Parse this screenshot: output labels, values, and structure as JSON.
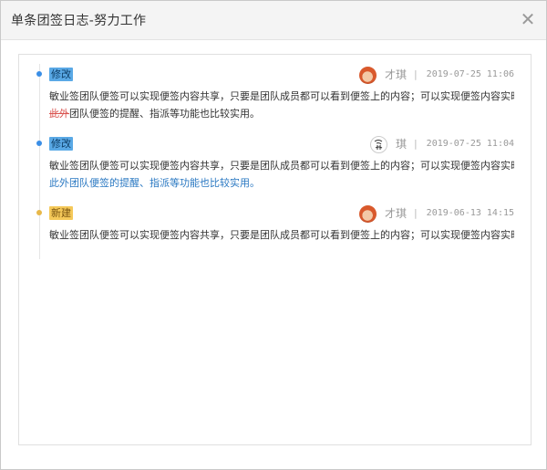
{
  "dialog": {
    "title": "单条团签日志-努力工作",
    "close_icon": "close-icon"
  },
  "colors": {
    "edit_tag_bg": "#5aa9e6",
    "new_tag_bg": "#f5c95a",
    "added_text": "#2a78c2",
    "deleted_text": "#d9534f"
  },
  "entries": [
    {
      "tag": "修改",
      "tag_type": "edit",
      "author": "才琪",
      "separator": "|",
      "time": "2019-07-25 11:06",
      "avatar": "photo-avatar",
      "line1": "敏业签团队便签可以实现便签内容共享，只要是团队成员都可以看到便签上的内容；可以实现便签内容实时同步",
      "line2_deleted": "此外",
      "line2_rest": "团队便签的提醒、指派等功能也比较实用。"
    },
    {
      "tag": "修改",
      "tag_type": "edit",
      "author": "琪",
      "separator": "|",
      "time": "2019-07-25 11:04",
      "avatar": "sketch-avatar",
      "line1": "敏业签团队便签可以实现便签内容共享，只要是团队成员都可以看到便签上的内容；可以实现便签内容实时同步",
      "line2_added": "此外团队便签的提醒、指派等功能也比较实用。"
    },
    {
      "tag": "新建",
      "tag_type": "new",
      "author": "才琪",
      "separator": "|",
      "time": "2019-06-13 14:15",
      "avatar": "photo-avatar",
      "line1": "敏业签团队便签可以实现便签内容共享，只要是团队成员都可以看到便签上的内容；可以实现便签内容实时同步"
    }
  ]
}
